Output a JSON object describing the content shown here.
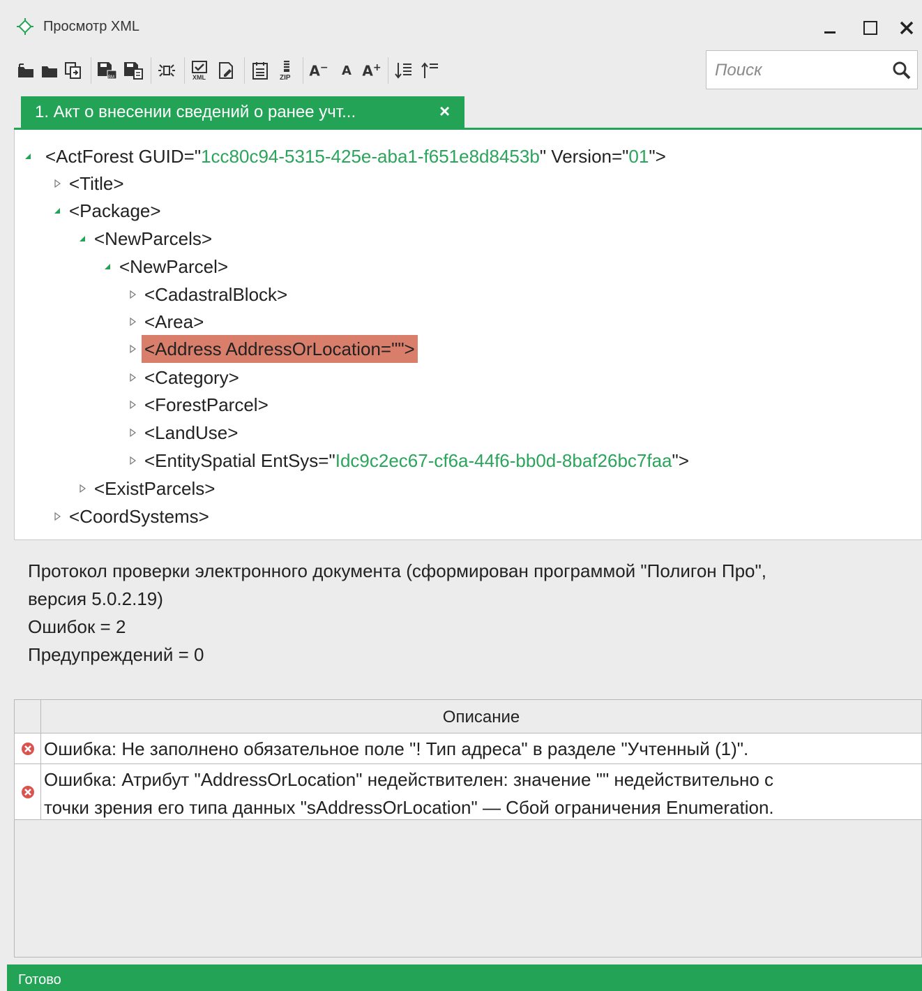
{
  "window": {
    "title": "Просмотр XML",
    "min_label": "_",
    "max_label": "☐",
    "close_label": "✕"
  },
  "toolbar": {
    "icons": [
      "open-file-icon",
      "open-folder-icon",
      "convert-icon",
      "save-icon",
      "save-as-icon",
      "expand-icon",
      "validate-xml-icon",
      "edit-icon",
      "calendar-icon",
      "zip-icon",
      "font-decrease-icon",
      "font-normal-icon",
      "font-increase-icon",
      "sort-down-icon",
      "sort-up-icon"
    ],
    "font_decrease": "A",
    "font_normal": "A",
    "font_increase": "A"
  },
  "search": {
    "placeholder": "Поиск",
    "value": ""
  },
  "tab": {
    "label": "1. Акт о внесении сведений о ранее учт...",
    "close": "×"
  },
  "tree": {
    "actforest": {
      "prefix": "<ActForest GUID=\"",
      "guid": "1cc80c94-5315-425e-aba1-f651e8d8453b",
      "mid": "\" Version=\"",
      "version": "01",
      "suffix": "\">"
    },
    "title": "<Title>",
    "package": "<Package>",
    "newparcels": "<NewParcels>",
    "newparcel": "<NewParcel>",
    "cadastralblock": "<CadastralBlock>",
    "area": "<Area>",
    "address": "<Address AddressOrLocation=\"\">",
    "category": "<Category>",
    "forestparcel": "<ForestParcel>",
    "landuse": "<LandUse>",
    "entityspatial": {
      "prefix": "<EntitySpatial EntSys=\"",
      "value": "Idc9c2ec67-cf6a-44f6-bb0d-8baf26bc7faa",
      "suffix": "\">"
    },
    "existparcels": "<ExistParcels>",
    "coordsystems": "<CoordSystems>"
  },
  "protocol": {
    "line1": "Протокол проверки электронного документа (сформирован программой \"Полигон Про\",",
    "line2": "версия 5.0.2.19)",
    "errors": "Ошибок = 2",
    "warnings": "Предупреждений = 0"
  },
  "grid": {
    "header": "Описание",
    "rows": [
      {
        "text": "Ошибка: Не заполнено обязательное поле \"! Тип адреса\" в разделе \"Учтенный (1)\"."
      },
      {
        "line1": "Ошибка: Атрибут \"AddressOrLocation\" недействителен: значение \"\" недействительно с",
        "line2": "точки зрения его типа данных \"sAddressOrLocation\" — Сбой ограничения Enumeration."
      }
    ]
  },
  "status": {
    "text": "Готово"
  },
  "colors": {
    "accent": "#23a356",
    "attr_value": "#2aa55b",
    "highlight": "#d97e6a",
    "error": "#d9534f"
  }
}
